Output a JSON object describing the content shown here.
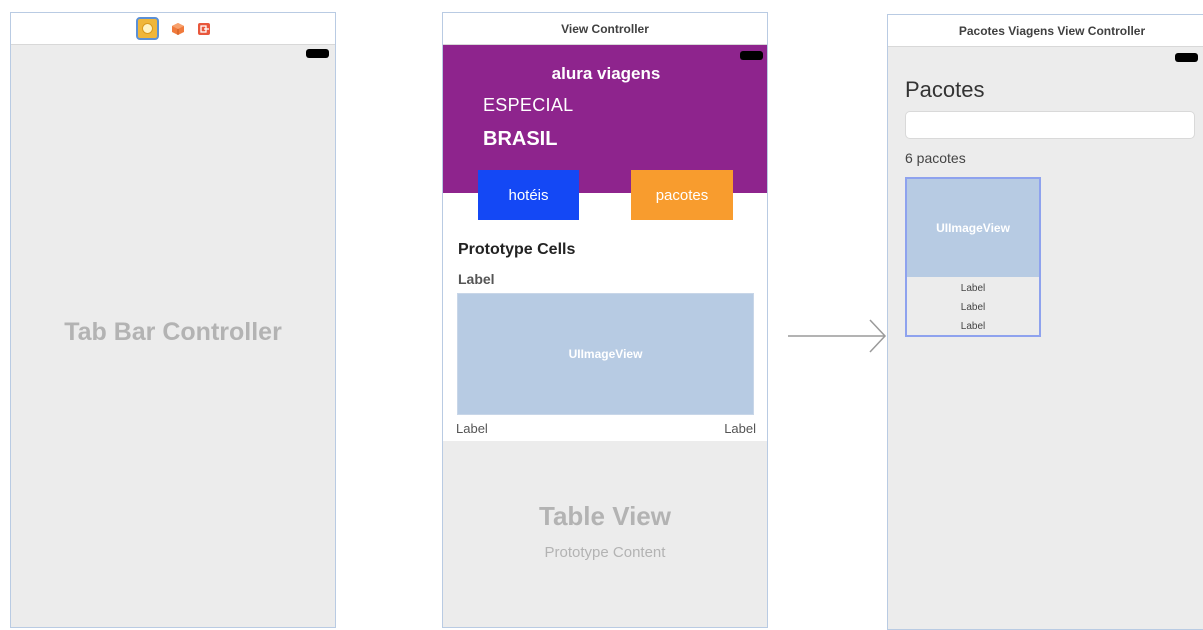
{
  "scenes": {
    "tab_bar": {
      "title": "Tab Bar Controller",
      "icons": [
        "view-controller-icon",
        "first-responder-icon",
        "exit-icon"
      ]
    },
    "view_controller": {
      "title": "View Controller",
      "brand": "alura viagens",
      "especial": "ESPECIAL",
      "brasil": "BRASIL",
      "btn_hoteis": "hotéis",
      "btn_pacotes": "pacotes",
      "prototype_cells": "Prototype Cells",
      "cell_label_top": "Label",
      "image_view": "UIImageView",
      "cell_label_left": "Label",
      "cell_label_right": "Label",
      "table_view": "Table View",
      "prototype_content": "Prototype Content"
    },
    "pacotes": {
      "title": "Pacotes Viagens View Controller",
      "heading": "Pacotes",
      "search_value": "",
      "count_label": "6 pacotes",
      "image_view": "UIImageView",
      "labels": [
        "Label",
        "Label",
        "Label"
      ]
    }
  },
  "colors": {
    "purple": "#8e248d",
    "hoteis_button": "#1448f5",
    "pacotes_button": "#f89c2e",
    "image_view": "#b7cbe3",
    "selection_border": "#8ea2ee"
  }
}
